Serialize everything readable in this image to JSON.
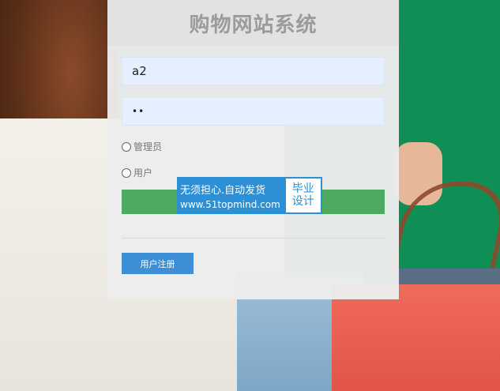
{
  "login": {
    "title": "购物网站系统",
    "username_value": "a2",
    "password_masked": "••",
    "role_admin_label": "管理员",
    "role_user_label": "用户",
    "register_label": "用户注册"
  },
  "watermark": {
    "line1": "无须担心.自动发货",
    "line2": "www.51topmind.com",
    "badge_line1": "毕业",
    "badge_line2": "设计"
  },
  "colors": {
    "background_green": "#0f8f56",
    "login_bar_green": "#4cab5e",
    "register_blue": "#3e8fd6",
    "input_bg": "#e6efff"
  }
}
